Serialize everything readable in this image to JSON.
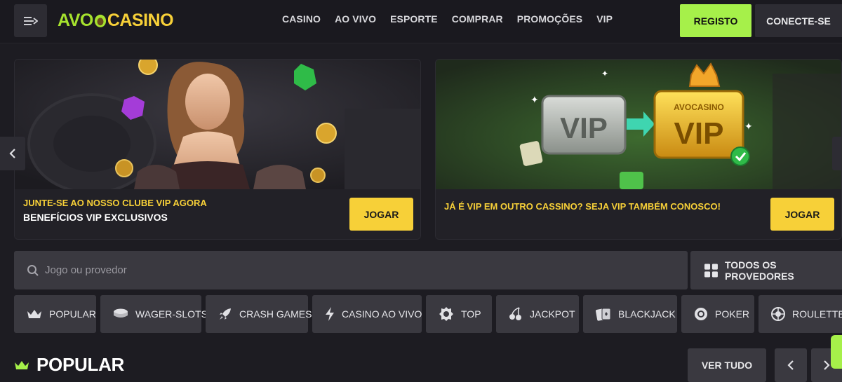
{
  "header": {
    "logo": {
      "avo": "AVO",
      "casino": "CASINO"
    },
    "nav": [
      "CASINO",
      "AO VIVO",
      "ESPORTE",
      "COMPRAR",
      "PROMOÇÕES",
      "VIP"
    ],
    "registo_label": "REGISTO",
    "conecte_label": "CONECTE-SE",
    "menu_icon": "menu-arrow-icon"
  },
  "banners": [
    {
      "line1": "JUNTE-SE AO NOSSO CLUBE VIP AGORA",
      "line2": "BENEFÍCIOS VIP EXCLUSIVOS",
      "button": "JOGAR"
    },
    {
      "line1": "JÁ É VIP EM OUTRO CASSINO? SEJA VIP TAMBÉM CONOSCO!",
      "button": "JOGAR",
      "art_text": {
        "vip_left": "VIP",
        "brand": "AVOCASINO",
        "vip_right": "VIP"
      }
    }
  ],
  "search": {
    "placeholder": "Jogo ou provedor"
  },
  "providers_label": "TODOS OS PROVEDORES",
  "categories": [
    {
      "label": "POPULAR",
      "icon": "crown-icon"
    },
    {
      "label": "WAGER-SLOTS",
      "icon": "coins-icon"
    },
    {
      "label": "CRASH GAMES",
      "icon": "rocket-icon"
    },
    {
      "label": "CASINO AO VIVO",
      "icon": "lightning-icon"
    },
    {
      "label": "TOP",
      "icon": "badge-icon"
    },
    {
      "label": "JACKPOT",
      "icon": "cherry-icon"
    },
    {
      "label": "BLACKJACK",
      "icon": "cards-icon"
    },
    {
      "label": "POKER",
      "icon": "chip-icon"
    },
    {
      "label": "ROULETTE",
      "icon": "roulette-icon"
    }
  ],
  "popular": {
    "title": "POPULAR",
    "ver_tudo": "VER TUDO"
  },
  "colors": {
    "accent_green": "#a6f04a",
    "accent_yellow": "#f7d038",
    "bg": "#1d1c22",
    "panel": "#3a3940"
  }
}
